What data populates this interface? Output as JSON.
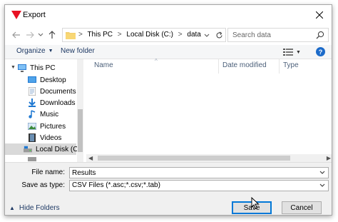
{
  "window": {
    "title": "Export",
    "colors": {
      "accent": "#0078d7",
      "app_icon": "#e81123",
      "help": "#1b6ac9",
      "link": "#1e3964"
    }
  },
  "icons": {
    "close": "close-icon",
    "back": "back-arrow-icon",
    "forward": "forward-arrow-icon",
    "recent": "chevron-down-icon",
    "up": "up-arrow-icon",
    "refresh": "refresh-icon",
    "search": "search-icon",
    "help": "help-icon"
  },
  "address": {
    "crumbs": [
      "This PC",
      "Local Disk (C:)",
      "data"
    ],
    "separator": ">"
  },
  "search": {
    "placeholder": "Search data"
  },
  "toolbar": {
    "organize": "Organize",
    "new_folder": "New folder",
    "help_glyph": "?"
  },
  "nav": {
    "items": [
      {
        "label": "This PC",
        "icon": "computer-icon"
      },
      {
        "label": "Desktop",
        "icon": "desktop-icon"
      },
      {
        "label": "Documents",
        "icon": "documents-icon"
      },
      {
        "label": "Downloads",
        "icon": "downloads-icon"
      },
      {
        "label": "Music",
        "icon": "music-icon"
      },
      {
        "label": "Pictures",
        "icon": "pictures-icon"
      },
      {
        "label": "Videos",
        "icon": "videos-icon"
      },
      {
        "label": "Local Disk (C:)",
        "icon": "drive-icon",
        "selected": true
      }
    ]
  },
  "files": {
    "columns": [
      "Name",
      "Date modified",
      "Type"
    ],
    "rows": []
  },
  "form": {
    "file_name_label": "File name:",
    "file_name_value": "Results",
    "save_as_type_label": "Save as type:",
    "save_as_type_value": "CSV Files (*.asc;*.csv;*.tab)"
  },
  "footer": {
    "hide_folders": "Hide Folders",
    "save": "Save",
    "cancel": "Cancel"
  }
}
